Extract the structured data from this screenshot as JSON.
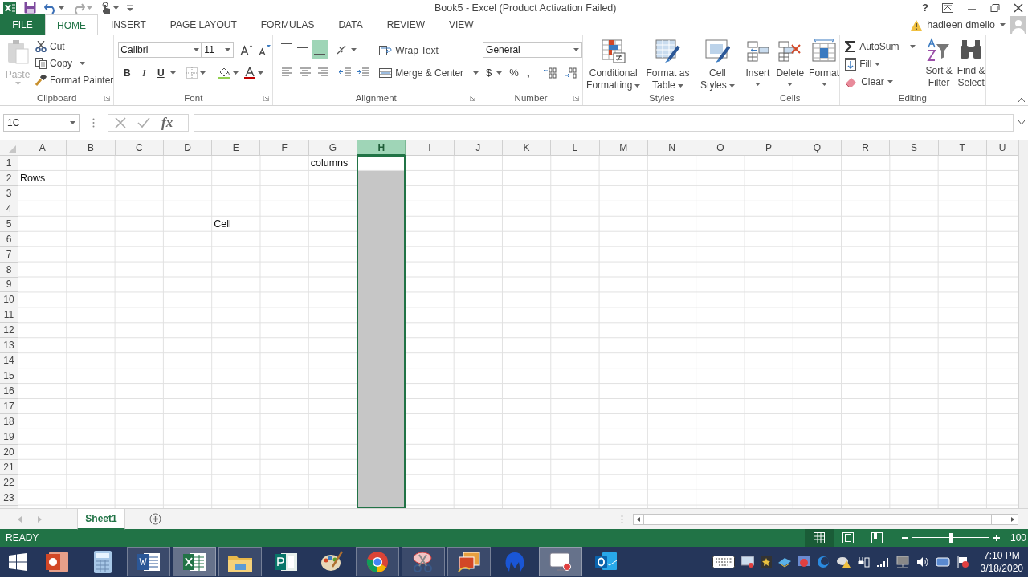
{
  "title_bar": {
    "title": "Book5 - Excel (Product Activation Failed)",
    "help": "?"
  },
  "ribbon_tabs": [
    {
      "label": "FILE",
      "kind": "file",
      "selected": false
    },
    {
      "label": "HOME",
      "kind": "tab",
      "selected": true
    },
    {
      "label": "INSERT",
      "kind": "tab",
      "selected": false
    },
    {
      "label": "PAGE LAYOUT",
      "kind": "tab",
      "selected": false
    },
    {
      "label": "FORMULAS",
      "kind": "tab",
      "selected": false
    },
    {
      "label": "DATA",
      "kind": "tab",
      "selected": false
    },
    {
      "label": "REVIEW",
      "kind": "tab",
      "selected": false
    },
    {
      "label": "VIEW",
      "kind": "tab",
      "selected": false
    }
  ],
  "account": {
    "user": "hadleen dmello"
  },
  "ribbon": {
    "clipboard": {
      "label": "Clipboard",
      "paste": "Paste",
      "paste_disabled": true,
      "cut": "Cut",
      "copy": "Copy",
      "format_painter": "Format Painter"
    },
    "font": {
      "label": "Font",
      "name": "Calibri",
      "size": "11",
      "bold": "B",
      "italic": "I",
      "underline": "U"
    },
    "alignment": {
      "label": "Alignment",
      "bottom_align_selected": true,
      "wrap_text": "Wrap Text",
      "merge": "Merge & Center"
    },
    "number": {
      "label": "Number",
      "format": "General",
      "currency": "$",
      "percent": "%",
      "comma": ","
    },
    "styles": {
      "label": "Styles",
      "buttons": [
        {
          "kind": "conditional",
          "lines": [
            "Conditional",
            "Formatting"
          ]
        },
        {
          "kind": "table",
          "lines": [
            "Format as",
            "Table"
          ]
        },
        {
          "kind": "cellstyles",
          "lines": [
            "Cell",
            "Styles"
          ]
        }
      ]
    },
    "cells": {
      "label": "Cells",
      "buttons": [
        {
          "kind": "insert",
          "label": "Insert"
        },
        {
          "kind": "delete",
          "label": "Delete"
        },
        {
          "kind": "format",
          "label": "Format"
        }
      ]
    },
    "editing": {
      "label": "Editing",
      "autosum": "AutoSum",
      "fill": "Fill",
      "clear": "Clear",
      "sort": [
        "Sort &",
        "Filter"
      ],
      "find": [
        "Find &",
        "Select"
      ]
    }
  },
  "formula_bar": {
    "name_box": "1C",
    "fx": "fx"
  },
  "sheet": {
    "columns": [
      {
        "label": "A",
        "selected": false
      },
      {
        "label": "B",
        "selected": false
      },
      {
        "label": "C",
        "selected": false
      },
      {
        "label": "D",
        "selected": false
      },
      {
        "label": "E",
        "selected": false
      },
      {
        "label": "F",
        "selected": false
      },
      {
        "label": "G",
        "selected": false
      },
      {
        "label": "H",
        "selected": true
      },
      {
        "label": "I",
        "selected": false
      },
      {
        "label": "J",
        "selected": false
      },
      {
        "label": "K",
        "selected": false
      },
      {
        "label": "L",
        "selected": false
      },
      {
        "label": "M",
        "selected": false
      },
      {
        "label": "N",
        "selected": false
      },
      {
        "label": "O",
        "selected": false
      },
      {
        "label": "P",
        "selected": false
      },
      {
        "label": "Q",
        "selected": false
      },
      {
        "label": "R",
        "selected": false
      },
      {
        "label": "S",
        "selected": false
      },
      {
        "label": "T",
        "selected": false
      },
      {
        "label": "U",
        "selected": false
      }
    ],
    "rows": [
      {
        "label": "1",
        "cells": {
          "G": "columns"
        }
      },
      {
        "label": "2",
        "cells": {
          "A": "Rows"
        }
      },
      {
        "label": "3"
      },
      {
        "label": "4"
      },
      {
        "label": "5",
        "cells": {
          "E": "Cell"
        }
      },
      {
        "label": "6"
      },
      {
        "label": "7"
      },
      {
        "label": "8"
      },
      {
        "label": "9"
      },
      {
        "label": "10"
      },
      {
        "label": "11"
      },
      {
        "label": "12"
      },
      {
        "label": "13"
      },
      {
        "label": "14"
      },
      {
        "label": "15"
      },
      {
        "label": "16"
      },
      {
        "label": "17"
      },
      {
        "label": "18"
      },
      {
        "label": "19"
      },
      {
        "label": "20"
      },
      {
        "label": "21"
      },
      {
        "label": "22"
      },
      {
        "label": "23"
      }
    ]
  },
  "sheet_tabs": [
    {
      "label": "Sheet1",
      "selected": true
    }
  ],
  "status_bar": {
    "mode": "READY",
    "views": [
      {
        "kind": "normal",
        "selected": true
      },
      {
        "kind": "page_layout",
        "selected": false
      },
      {
        "kind": "page_break",
        "selected": false
      }
    ],
    "zoom_slider": {
      "level": 0.5
    },
    "zoom": "100"
  },
  "taskbar": {
    "apps": [
      {
        "kind": "powerpoint",
        "running": false,
        "selected": false
      },
      {
        "kind": "calculator",
        "running": false,
        "selected": false
      },
      {
        "kind": "word",
        "running": true,
        "selected": false
      },
      {
        "kind": "excel",
        "running": true,
        "selected": true
      },
      {
        "kind": "explorer",
        "running": true,
        "selected": false
      },
      {
        "kind": "publisher",
        "running": false,
        "selected": false
      },
      {
        "kind": "paint",
        "running": false,
        "selected": false
      },
      {
        "kind": "chrome",
        "running": true,
        "selected": false
      },
      {
        "kind": "snipping",
        "running": true,
        "selected": false
      },
      {
        "kind": "photos",
        "running": true,
        "selected": false
      },
      {
        "kind": "shield",
        "running": false,
        "selected": false
      },
      {
        "kind": "recorder",
        "running": true,
        "selected": true
      },
      {
        "kind": "outlook",
        "running": false,
        "selected": false
      }
    ],
    "time": "7:10 PM",
    "date": "3/18/2020"
  }
}
